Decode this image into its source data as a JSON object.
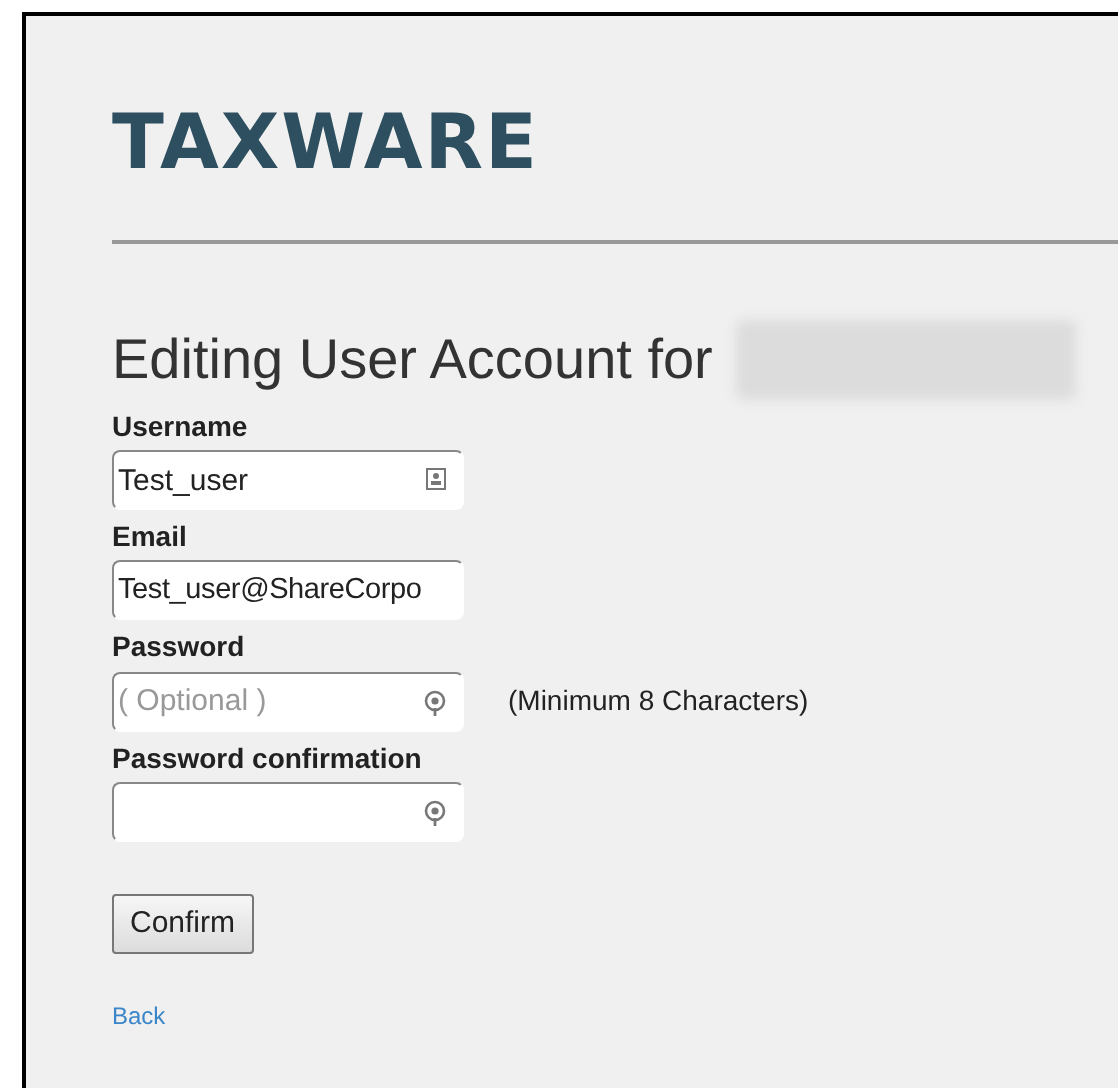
{
  "logo": "TAXWARE",
  "heading": "Editing User Account for",
  "fields": [
    {
      "label": "Username",
      "value": "Test_user",
      "kind": "username"
    },
    {
      "label": "Email",
      "value": "Test_user@ShareCorpo",
      "kind": "email"
    },
    {
      "label": "Password",
      "placeholder": "( Optional )",
      "kind": "password",
      "note": "(Minimum 8 Characters)"
    },
    {
      "label": "Password confirmation",
      "kind": "password"
    }
  ],
  "button": "Confirm",
  "link": "Back"
}
